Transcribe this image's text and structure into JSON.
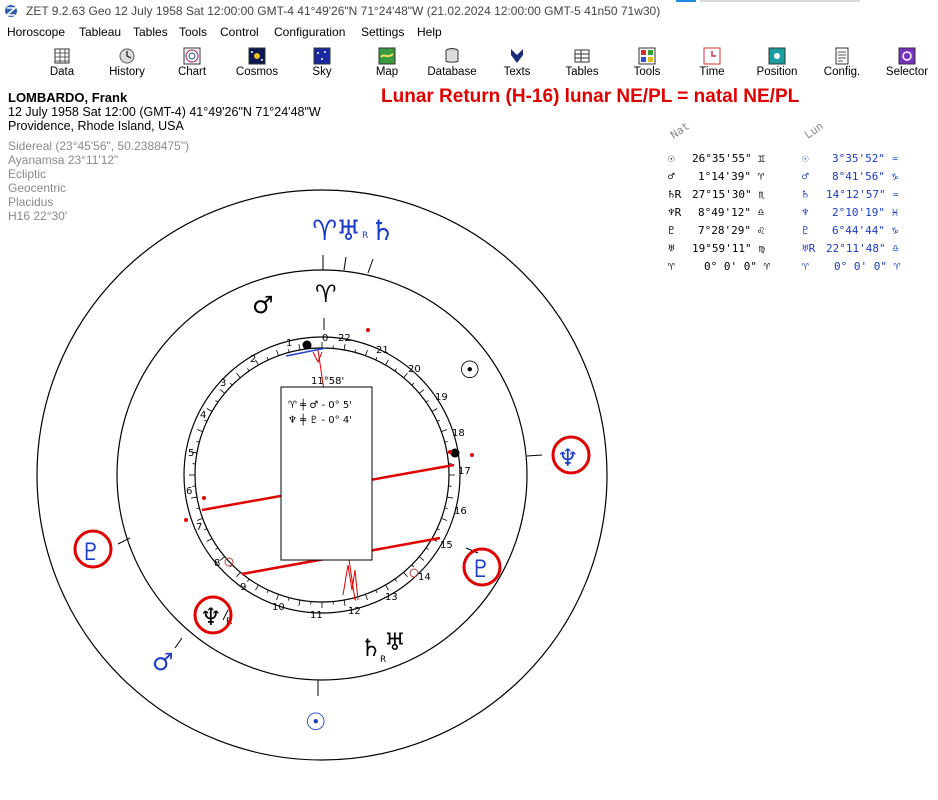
{
  "window": {
    "title": "ZET 9.2.63 Geo   12 July 1958  Sat  12:00:00 GMT-4 41°49'26\"N  71°24'48\"W  (21.02.2024  12:00:00 GMT-5 41n50 71w30)"
  },
  "menu": [
    "Horoscope",
    "Tableau",
    "Tables",
    "Tools",
    "Control",
    "Configuration",
    "Settings",
    "Help"
  ],
  "toolbar": [
    {
      "label": "Data",
      "icon": "data-icon"
    },
    {
      "label": "History",
      "icon": "history-icon"
    },
    {
      "label": "Chart",
      "icon": "chart-icon"
    },
    {
      "label": "Cosmos",
      "icon": "cosmos-icon"
    },
    {
      "label": "Sky",
      "icon": "sky-icon"
    },
    {
      "label": "Map",
      "icon": "map-icon"
    },
    {
      "label": "Database",
      "icon": "database-icon"
    },
    {
      "label": "Texts",
      "icon": "texts-icon"
    },
    {
      "label": "Tables",
      "icon": "tables-icon"
    },
    {
      "label": "Tools",
      "icon": "tools-icon"
    },
    {
      "label": "Time",
      "icon": "time-icon"
    },
    {
      "label": "Position",
      "icon": "position-icon"
    },
    {
      "label": "Config.",
      "icon": "config-icon"
    },
    {
      "label": "Selector",
      "icon": "selector-icon"
    }
  ],
  "person": {
    "name": "LOMBARDO, Frank",
    "datetime": "12 July 1958  Sat  12:00 (GMT-4) 41°49'26\"N  71°24'48\"W",
    "place": "Providence, Rhode Island, USA",
    "settings": [
      "Sidereal (23°45'56\", 50.2388475\")",
      "Ayanamsa 23°11'12\"",
      "Ecliptic",
      "Geocentric",
      "Placidus",
      "H16  22°30'"
    ]
  },
  "chart_title": "Lunar Return (H-16) lunar NE/PL = natal NE/PL",
  "positions": {
    "nat_header": "Nat",
    "lun_header": "Lun",
    "rows": [
      {
        "nat_glyph": "☉",
        "nat": "26°35'55\" ♊",
        "lun_glyph": "☉",
        "lun": "3°35'52\" ♒"
      },
      {
        "nat_glyph": "♂",
        "nat": "1°14'39\" ♈",
        "lun_glyph": "♂",
        "lun": "8°41'56\" ♑"
      },
      {
        "nat_glyph": "♄R",
        "nat": "27°15'30\" ♏",
        "lun_glyph": "♄",
        "lun": "14°12'57\" ♒"
      },
      {
        "nat_glyph": "♆R",
        "nat": "8°49'12\" ♎",
        "lun_glyph": "♆",
        "lun": "2°10'19\" ♓"
      },
      {
        "nat_glyph": "♇",
        "nat": "7°28'29\" ♌",
        "lun_glyph": "♇",
        "lun": "6°44'44\" ♑"
      },
      {
        "nat_glyph": "♅",
        "nat": "19°59'11\" ♍",
        "lun_glyph": "♅R",
        "lun": "22°11'48\" ♎"
      },
      {
        "nat_glyph": "♈",
        "nat": "0° 0' 0\" ♈",
        "lun_glyph": "♈",
        "lun": "0° 0' 0\" ♈"
      }
    ]
  },
  "wheel": {
    "house_numbers": [
      "1",
      "2",
      "3",
      "4",
      "5",
      "6",
      "7",
      "8",
      "9",
      "10",
      "11",
      "12",
      "13",
      "14",
      "15",
      "16",
      "17",
      "18",
      "19",
      "20",
      "21",
      "22"
    ],
    "house_zero_label": "0",
    "asc_degree": "11°58'",
    "aspect_box": [
      "♈ ╪ ♂ - 0° 5'",
      "♆ ╪ ♇ - 0° 4'"
    ],
    "natal_glyphs": {
      "aries_label": "♈",
      "mars": "♂",
      "sun": "☉",
      "neptune": "♆",
      "neptune_r": "R",
      "pluto": "♇",
      "saturn": "♄",
      "saturn_r": "R",
      "uranus": "♅"
    },
    "lunar_glyphs": {
      "aries": "♈",
      "uranus": "♅",
      "uranus_r": "R",
      "saturn": "♄",
      "neptune": "♆",
      "pluto": "♇",
      "mars": "♂",
      "sun": "☉"
    }
  },
  "colors": {
    "natal": "#000000",
    "lunar": "#1a3cc8",
    "highlight": "#e00000",
    "aspect": "#e00000"
  }
}
